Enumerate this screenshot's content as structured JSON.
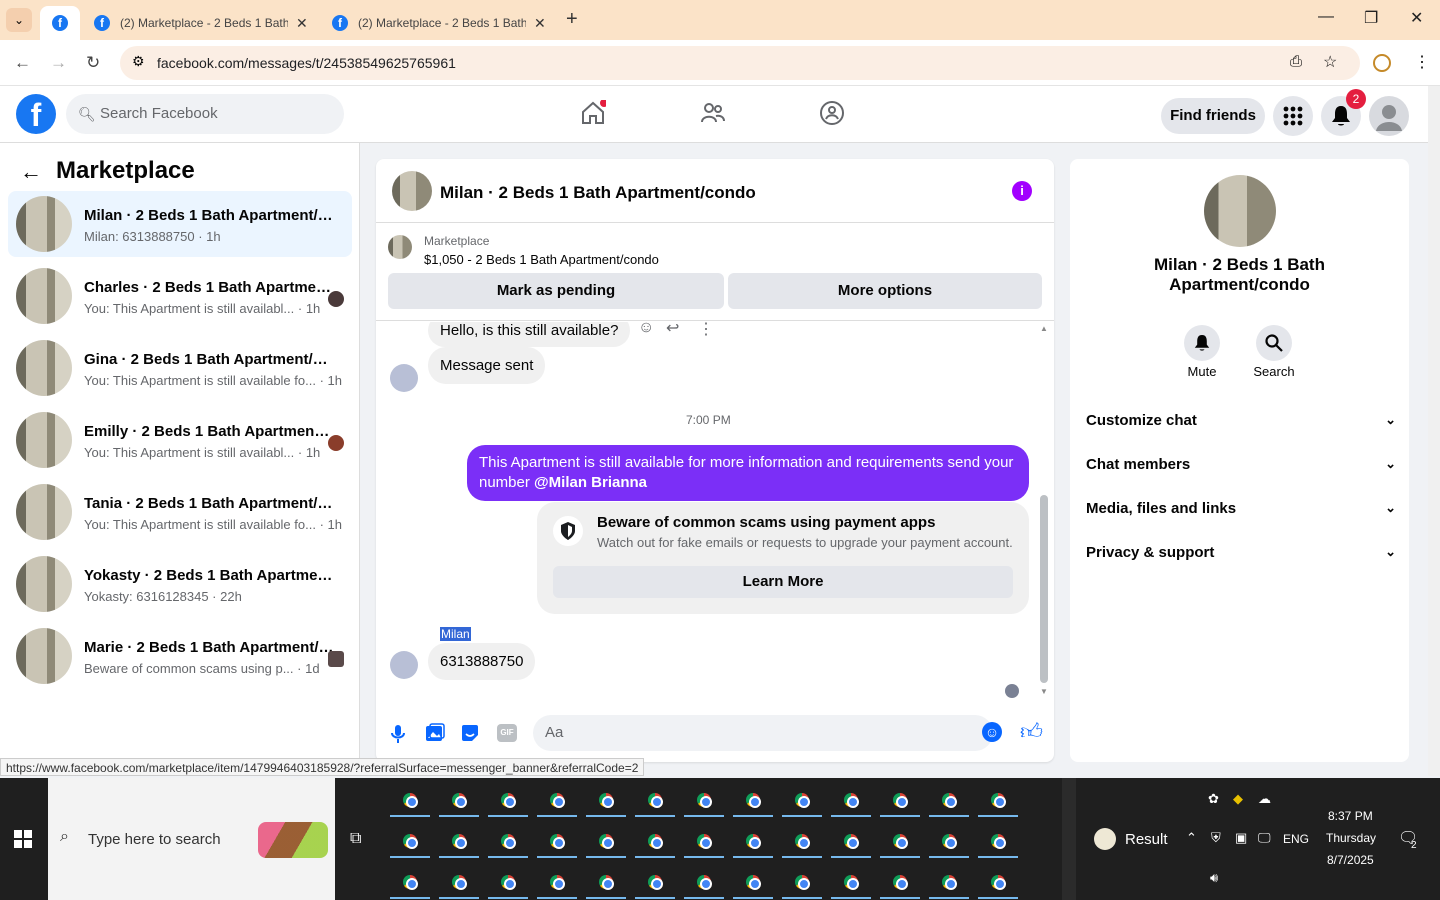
{
  "browser": {
    "tabs": [
      {
        "title": "",
        "active": true
      },
      {
        "title": "(2) Marketplace - 2 Beds 1 Bath"
      },
      {
        "title": "(2) Marketplace - 2 Beds 1 Bath"
      }
    ],
    "url": "facebook.com/messages/t/24538549625765961"
  },
  "fb": {
    "search_placeholder": "Search Facebook",
    "find_friends": "Find friends",
    "notif_count": "2"
  },
  "left": {
    "title": "Marketplace",
    "conversations": [
      {
        "name": "Milan · 2 Beds 1 Bath Apartment/condo",
        "preview": "Milan: 6313888750 · 1h",
        "selected": true
      },
      {
        "name": "Charles · 2 Beds 1 Bath Apartment/condo",
        "preview": "You: This Apartment is still availabl... · 1h"
      },
      {
        "name": "Gina · 2 Beds 1 Bath Apartment/condo",
        "preview": "You: This Apartment is still available fo... · 1h"
      },
      {
        "name": "Emilly · 2 Beds 1 Bath Apartment/condo",
        "preview": "You: This Apartment is still availabl... · 1h"
      },
      {
        "name": "Tania · 2 Beds 1 Bath Apartment/condo",
        "preview": "You: This Apartment is still available fo... · 1h"
      },
      {
        "name": "Yokasty · 2 Beds 1 Bath Apartment/condo",
        "preview": "Yokasty: 6316128345 · 22h"
      },
      {
        "name": "Marie · 2 Beds 1 Bath Apartment/condo",
        "preview": "Beware of common scams using p... · 1d"
      }
    ]
  },
  "chat": {
    "title": "Milan · 2 Beds 1 Bath Apartment/condo",
    "marketplace_label": "Marketplace",
    "listing": "$1,050 - 2 Beds 1 Bath Apartment/condo",
    "mark_pending": "Mark as pending",
    "more_options": "More options",
    "msg1": "Hello, is this still available?",
    "msg2": "Message sent",
    "time": "7:00 PM",
    "out_msg": "This Apartment is still available for more information and requirements send your number",
    "mention": "@Milan Brianna",
    "warn_title": "Beware of common scams using payment apps",
    "warn_desc": "Watch out for fake emails or requests to upgrade your payment account.",
    "learn_more": "Learn More",
    "sender": "Milan",
    "reply": "6313888750",
    "composer_placeholder": "Aa"
  },
  "right": {
    "name_line1": "Milan · 2 Beds 1 Bath",
    "name_line2": "Apartment/condo",
    "mute": "Mute",
    "search": "Search",
    "sections": [
      "Customize chat",
      "Chat members",
      "Media, files and links",
      "Privacy & support"
    ]
  },
  "status_url": "https://www.facebook.com/marketplace/item/1479946403185928/?referralSurface=messenger_banner&referralCode=2",
  "taskbar": {
    "search_placeholder": "Type here to search",
    "result": "Result",
    "lang": "ENG",
    "time": "8:37 PM",
    "day": "Thursday",
    "date": "8/7/2025",
    "notif": "2"
  },
  "colors": {
    "fb_blue": "#1877f2",
    "outgoing": "#7b2ff7",
    "accent": "#a200ff"
  }
}
